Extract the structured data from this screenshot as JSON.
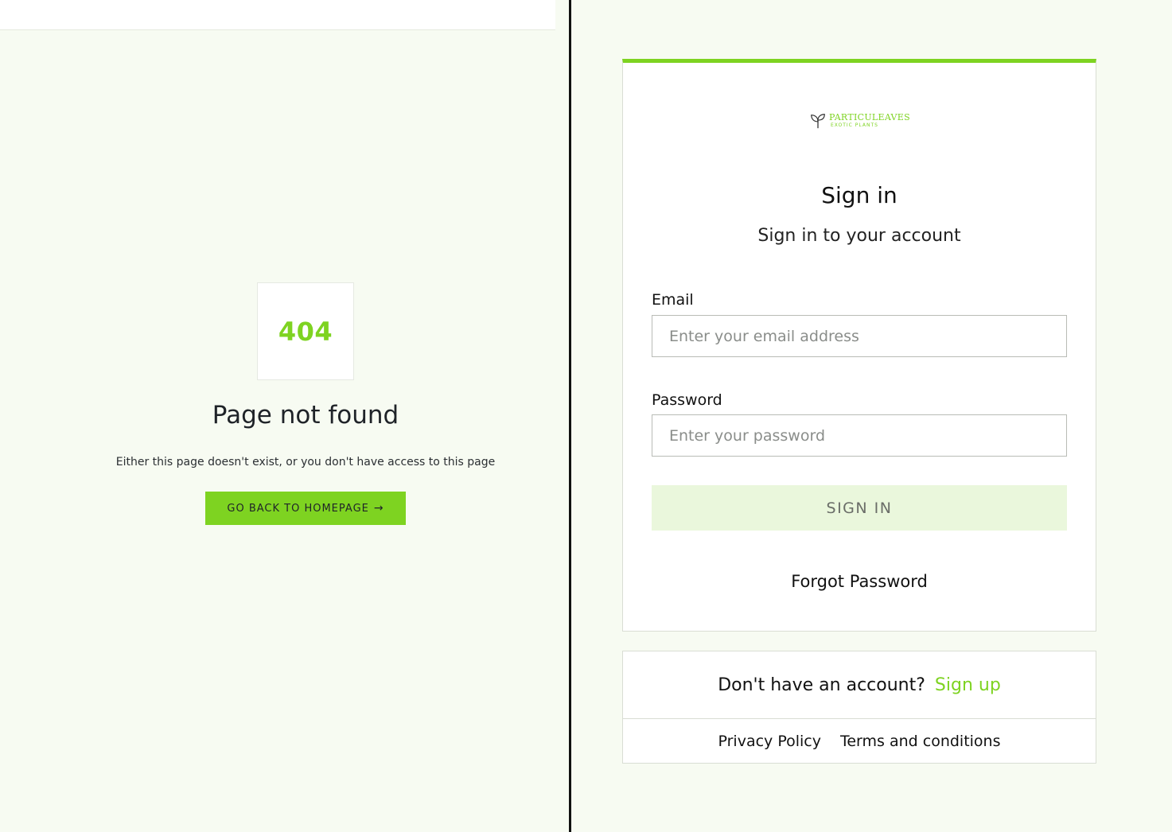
{
  "not_found": {
    "code": "404",
    "title": "Page not found",
    "description": "Either this page doesn't exist, or you don't have access to this page",
    "button_label": "GO BACK TO HOMEPAGE",
    "button_icon": "→"
  },
  "signin": {
    "logo": {
      "name": "PARTICULEAVES",
      "sub": "EXOTIC PLANTS"
    },
    "title": "Sign in",
    "subtitle": "Sign in to your account",
    "email_label": "Email",
    "email_placeholder": "Enter your email address",
    "password_label": "Password",
    "password_placeholder": "Enter your password",
    "submit_label": "SIGN IN",
    "forgot_label": "Forgot Password"
  },
  "footer": {
    "signup_question": "Don't have an account?",
    "signup_link": "Sign up",
    "privacy_link": "Privacy Policy",
    "terms_link": "Terms and conditions"
  },
  "colors": {
    "accent": "#7ed321",
    "accent_light": "#eaf7dc",
    "page_bg": "#f7fbf2"
  }
}
